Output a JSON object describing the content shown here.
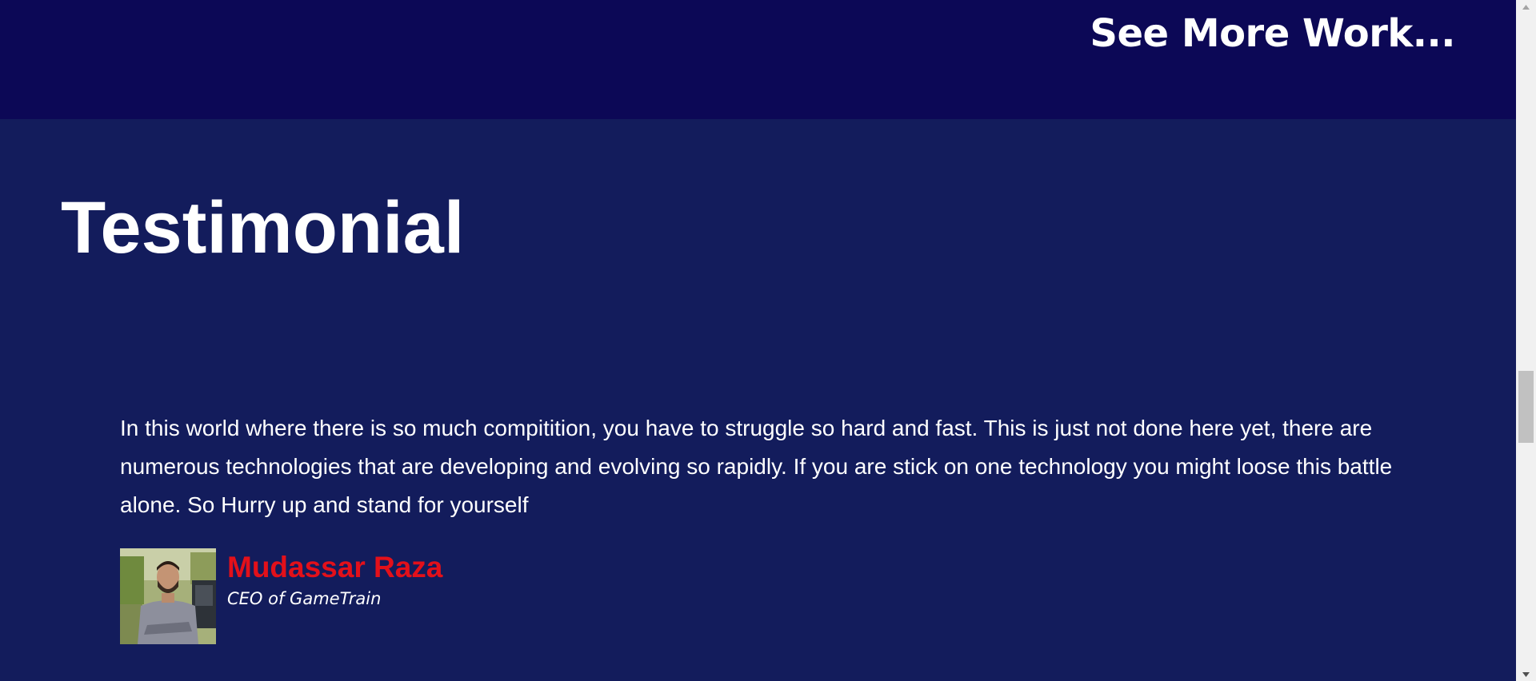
{
  "header": {
    "see_more_label": "See More Work..."
  },
  "testimonial": {
    "title": "Testimonial",
    "quote": "In this world where there is so much compitition, you have to struggle so hard and fast. This is just not done here yet, there are numerous technologies that are developing and evolving so rapidly. If you are stick on one technology you might loose this battle alone. So Hurry up and stand for yourself",
    "author_name": "Mudassar Raza",
    "author_role": "CEO of GameTrain"
  },
  "colors": {
    "top_band": "#0c0856",
    "section_bg": "#131c5c",
    "author_name": "#e3101a",
    "text": "#ffffff"
  },
  "icons": {
    "scroll_up": "triangle-up-icon",
    "scroll_down": "triangle-down-icon"
  }
}
